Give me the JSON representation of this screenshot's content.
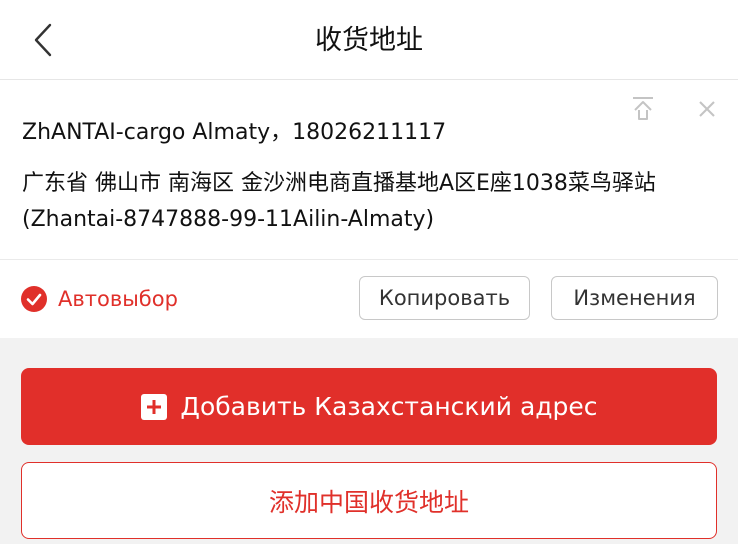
{
  "header": {
    "title": "收货地址",
    "back_icon": "chevron-left-icon"
  },
  "address_card": {
    "contact": "ZhANTAI-cargo Almaty，18026211117",
    "address": "广东省 佛山市 南海区 金沙洲电商直播基地A区E座1038菜鸟驿站(Zhantai-8747888-99-11Ailin-Almaty)",
    "pin_top_icon": "pin-to-top-icon",
    "close_icon": "close-icon"
  },
  "actions": {
    "auto_select_label": "Автовыбор",
    "copy_label": "Копировать",
    "edit_label": "Изменения"
  },
  "buttons": {
    "add_kz_label": "Добавить Казахстанский адрес",
    "add_cn_label": "添加中国收货地址"
  },
  "colors": {
    "accent": "#e12f2a",
    "background": "#f2f2f2",
    "card": "#ffffff"
  }
}
